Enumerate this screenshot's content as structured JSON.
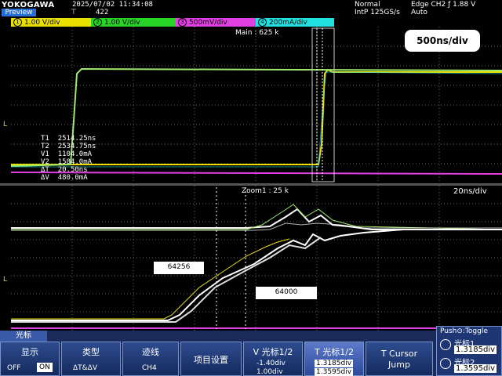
{
  "header": {
    "brand": "YOKOGAWA",
    "preview_label": "Preview",
    "timestamp": "2025/07/02 11:34:08",
    "trigger_symbol": "⊤",
    "acq_count": "422",
    "mode": "Normal",
    "sample_rate": "IntP 125GS/s",
    "trigger": "Edge CH2 ƒ 1.88 V",
    "acq_mode": "Auto"
  },
  "channels": [
    {
      "num": "1",
      "scale": "1.00 V/div",
      "color": "#e8e000"
    },
    {
      "num": "2",
      "scale": "1.00 V/div",
      "color": "#28d428"
    },
    {
      "num": "3",
      "scale": "500mV/div",
      "color": "#e040e0"
    },
    {
      "num": "4",
      "scale": "200mA/div",
      "color": "#20e0e0"
    }
  ],
  "main_window": {
    "title": "Main : 625 k",
    "timebase_badge": "500ns/div",
    "cursor_readout": [
      {
        "label": "T1",
        "value": "2514.25ns"
      },
      {
        "label": "T2",
        "value": "2534.75ns"
      },
      {
        "label": "V1",
        "value": "1104.0mA"
      },
      {
        "label": "V2",
        "value": "1584.0mA"
      },
      {
        "label": "ΔT",
        "value": "20.50ns"
      },
      {
        "label": "ΔV",
        "value": "480.0mA"
      }
    ]
  },
  "zoom_window": {
    "title": "Zoom1 : 25 k",
    "timebase": "20ns/div",
    "annotation_1": "64256",
    "annotation_2": "64000"
  },
  "softkeys": {
    "cursor_tab": "光标",
    "display": {
      "title": "显示",
      "off": "OFF",
      "on": "ON"
    },
    "type": {
      "title": "类型",
      "value": "ΔT&ΔV"
    },
    "trace": {
      "title": "迹线",
      "value": "CH4"
    },
    "items": {
      "title": "项目设置"
    },
    "v_cursor": {
      "title": "V 光标1/2",
      "v1": "-1.40div",
      "v2": "1.00div"
    },
    "t_cursor": {
      "title": "T 光标1/2",
      "t1": "1.3185div",
      "t2": "1.3595div"
    },
    "t_cursor_jump": {
      "title": "T Cursor",
      "sub": "Jump"
    },
    "push_toggle": {
      "title": "Push⊙:Toggle",
      "c1_label": "光标1",
      "c1": "1.3185div",
      "c2_label": "光标2",
      "c2": "1.3595div"
    }
  }
}
